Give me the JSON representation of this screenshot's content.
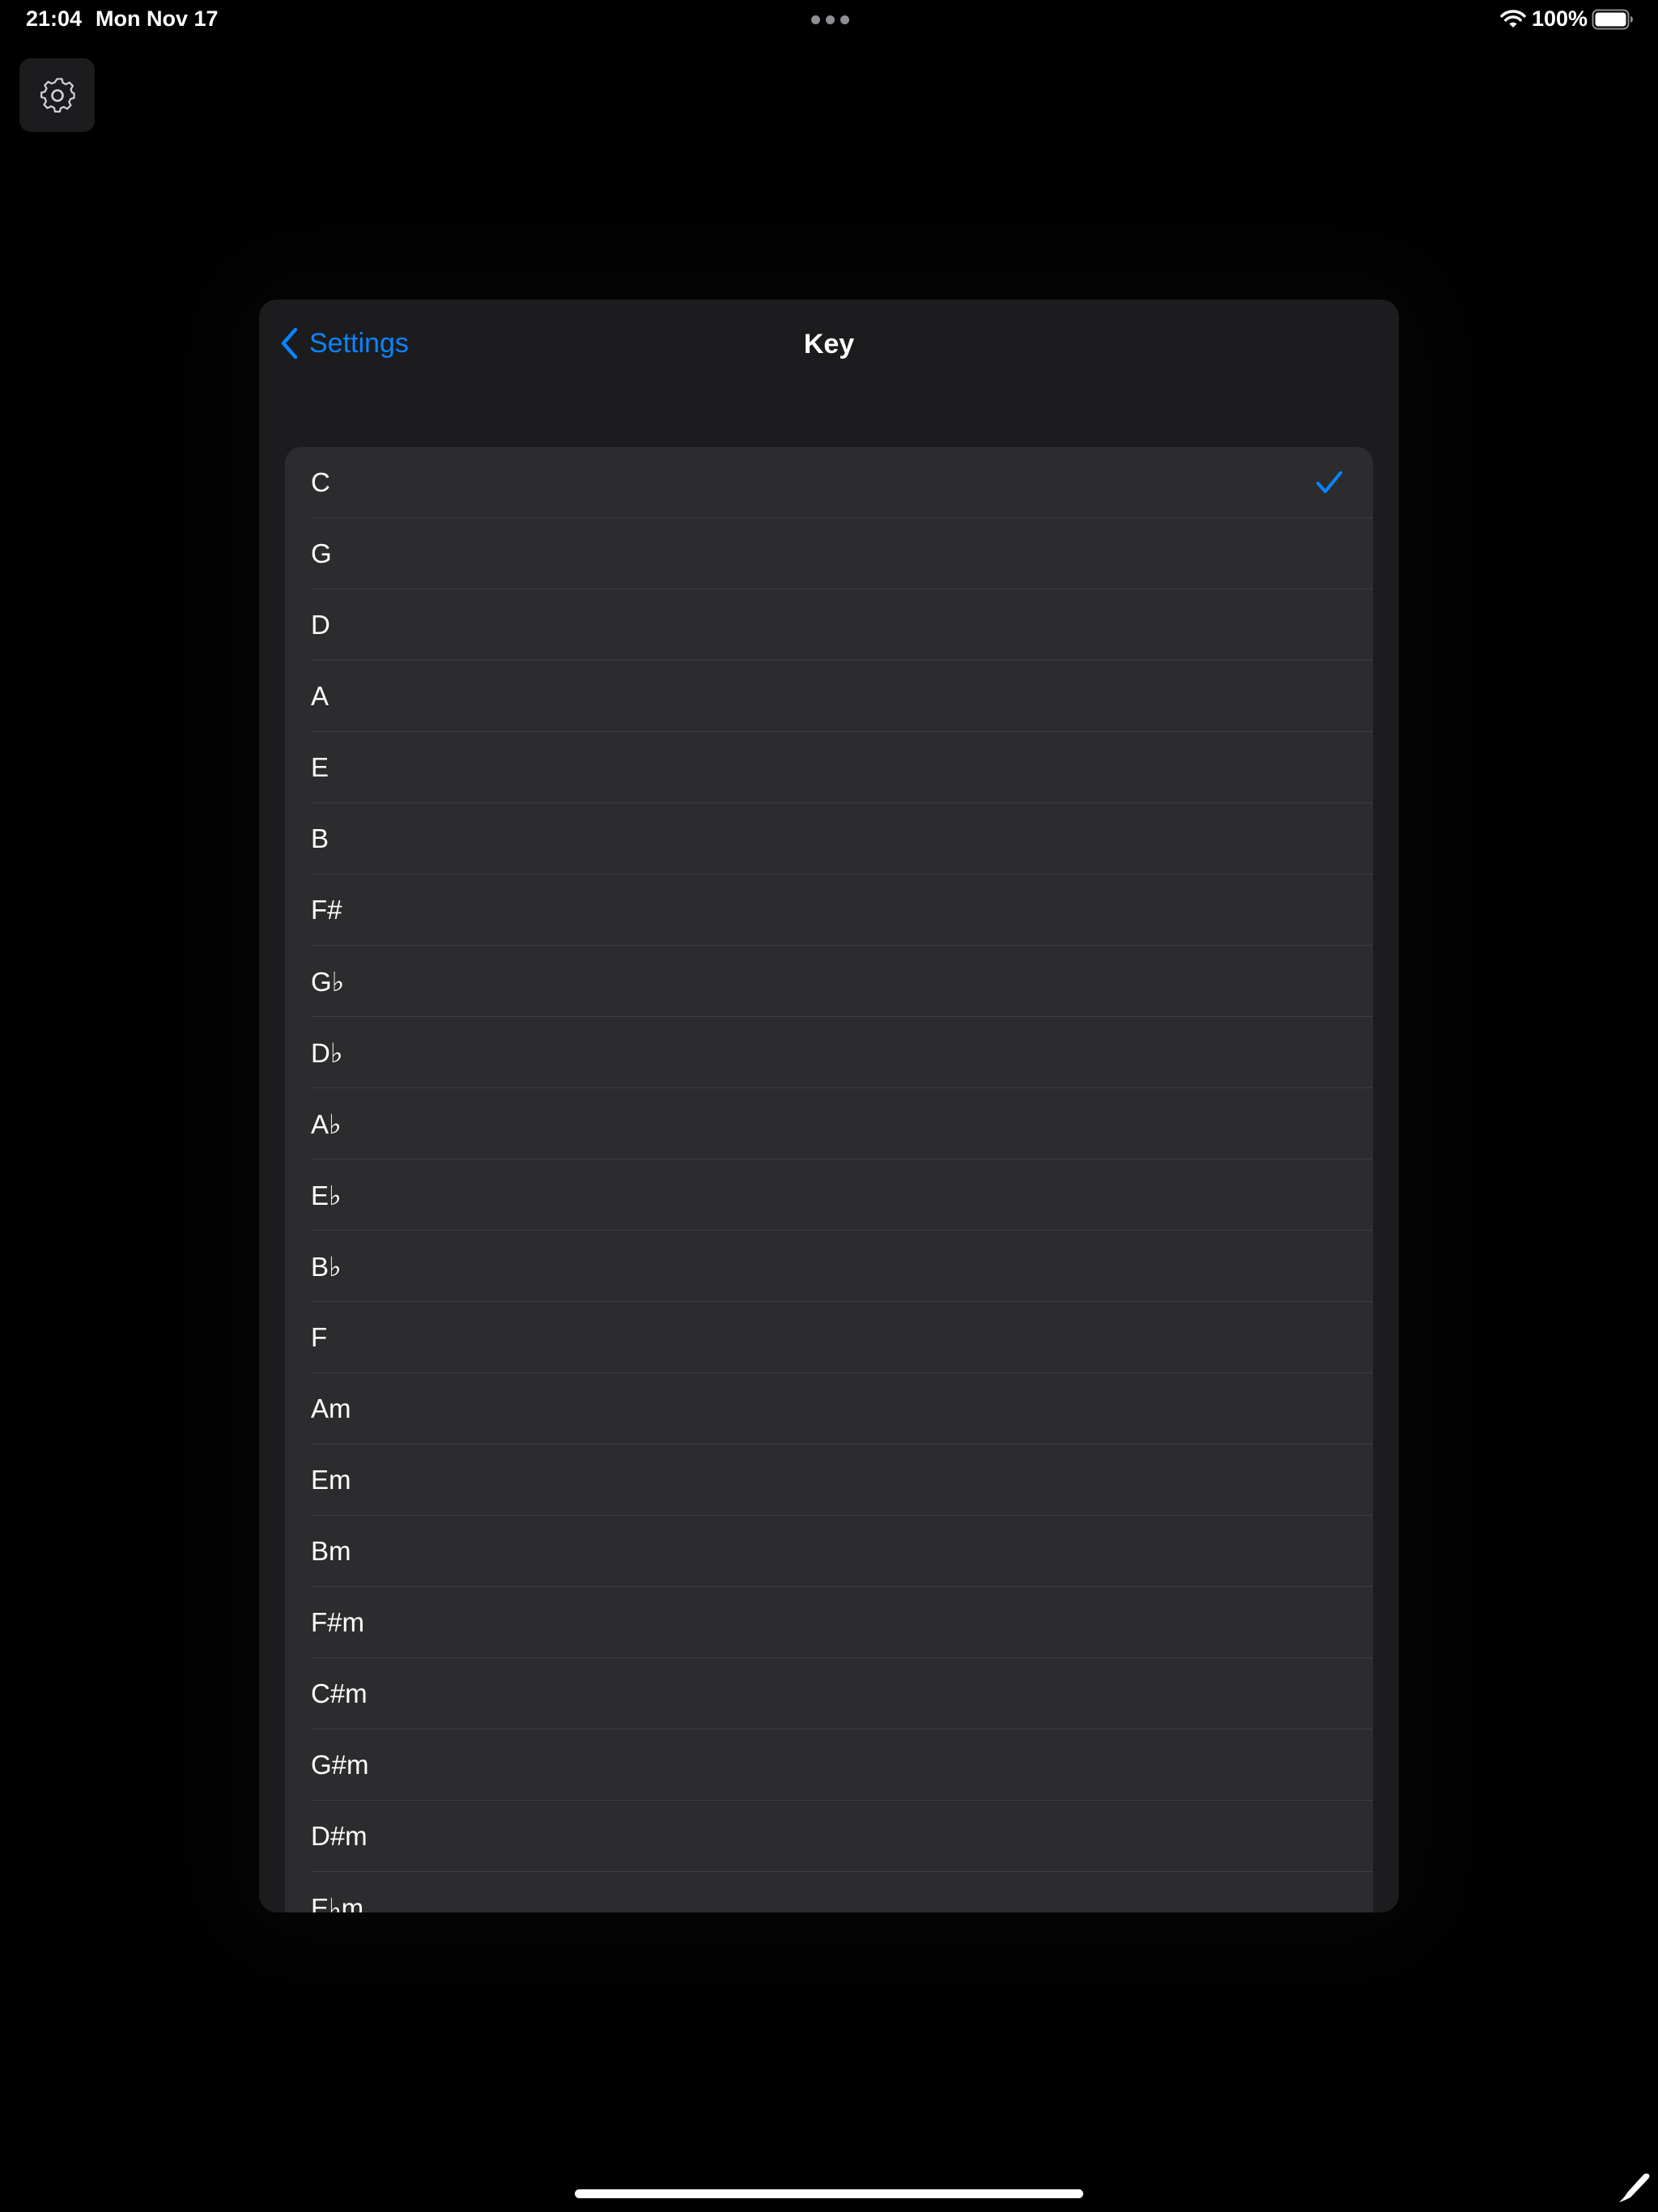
{
  "status_bar": {
    "time": "21:04",
    "date": "Mon Nov 17",
    "battery_percent": "100%",
    "icons": [
      "multitasking-dots-icon",
      "wifi-icon",
      "battery-icon"
    ]
  },
  "gear_button": {
    "icon": "gear-icon"
  },
  "sheet": {
    "back_label": "Settings",
    "title": "Key",
    "selected_key": "C",
    "keys": [
      {
        "label": "C",
        "selected": true
      },
      {
        "label": "G"
      },
      {
        "label": "D"
      },
      {
        "label": "A"
      },
      {
        "label": "E"
      },
      {
        "label": "B"
      },
      {
        "label": "F#"
      },
      {
        "label": "G♭"
      },
      {
        "label": "D♭"
      },
      {
        "label": "A♭"
      },
      {
        "label": "E♭"
      },
      {
        "label": "B♭"
      },
      {
        "label": "F"
      },
      {
        "label": "Am"
      },
      {
        "label": "Em"
      },
      {
        "label": "Bm"
      },
      {
        "label": "F#m"
      },
      {
        "label": "C#m"
      },
      {
        "label": "G#m"
      },
      {
        "label": "D#m"
      },
      {
        "label": "E♭m"
      }
    ]
  },
  "colors": {
    "accent": "#0a84ff",
    "background": "#000000",
    "sheet": "#1c1c1e",
    "cell": "#2c2c2e",
    "separator": "#3d3d41"
  }
}
